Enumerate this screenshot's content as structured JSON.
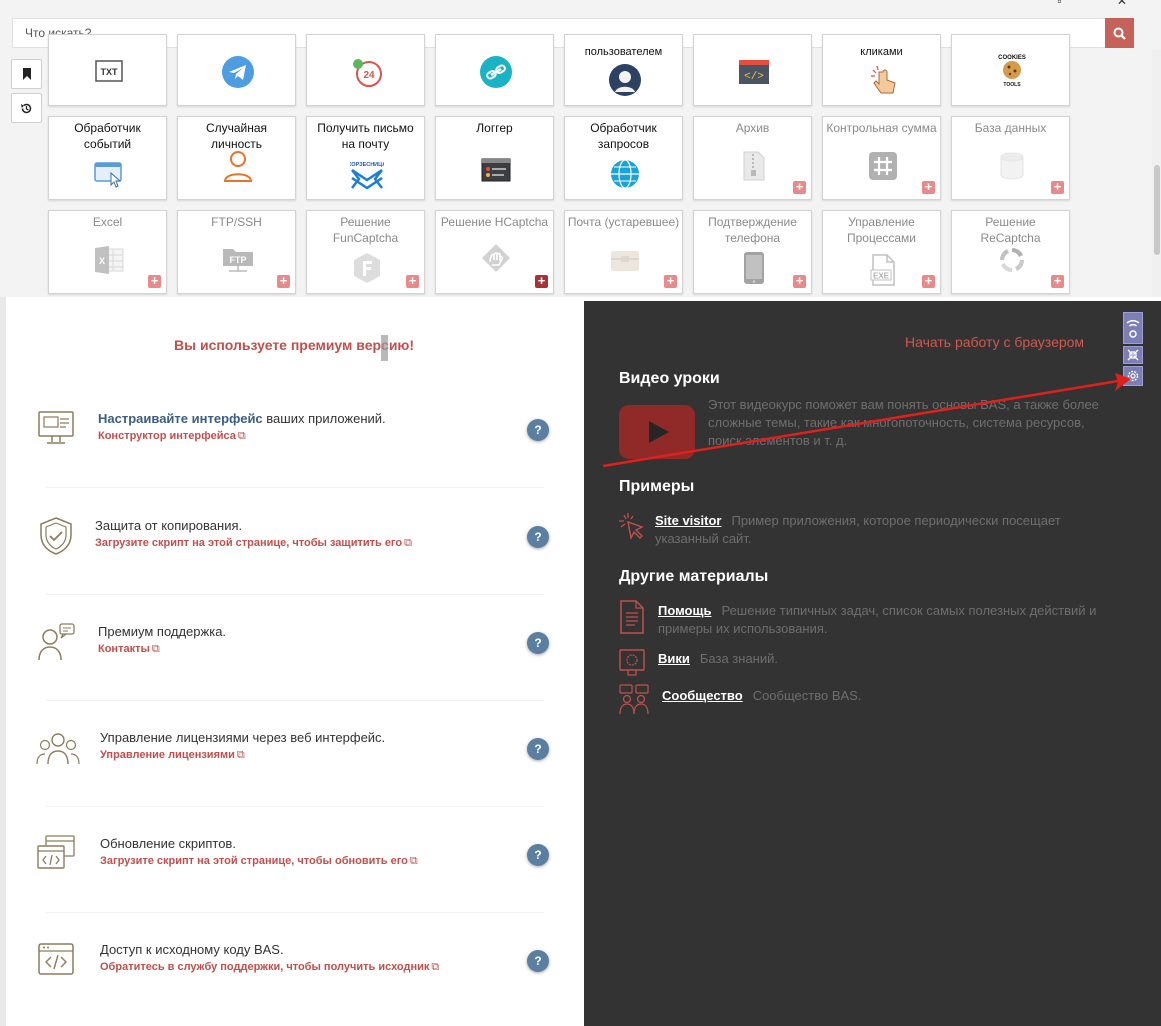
{
  "window": {
    "controls": "▫ ✕"
  },
  "search": {
    "placeholder": "Что искать?"
  },
  "tiles_row0": [
    {
      "label": "",
      "icon": "txt-icon"
    },
    {
      "label": "",
      "icon": "telegram-icon"
    },
    {
      "label": "",
      "icon": "24-hours-icon"
    },
    {
      "label": "",
      "icon": "link-icon"
    },
    {
      "label": "пользователем",
      "icon": "user-avatar-icon"
    },
    {
      "label": "",
      "icon": "code-window-icon"
    },
    {
      "label": "кликами",
      "icon": "pointer-hand-icon"
    },
    {
      "label": "",
      "icon": "cookies-tools-icon",
      "icon_text": "COOKIES TOOLS"
    }
  ],
  "tiles_row1": [
    {
      "label": "Обработчик событий",
      "icon": "event-window-icon"
    },
    {
      "label": "Случайная личность",
      "icon": "person-icon"
    },
    {
      "label": "Получить письмо на почту",
      "icon": "mail-logo-icon",
      "icon_text": "КОРЗЕСНИЦА"
    },
    {
      "label": "Логгер",
      "icon": "logger-icon"
    },
    {
      "label": "Обработчик запросов",
      "icon": "globe-icon"
    },
    {
      "label": "Архив",
      "icon": "zip-icon"
    },
    {
      "label": "Контрольная сумма",
      "icon": "hash-icon"
    },
    {
      "label": "База данных",
      "icon": "database-icon"
    }
  ],
  "tiles_row2": [
    {
      "label": "Excel",
      "icon": "excel-icon"
    },
    {
      "label": "FTP/SSH",
      "icon": "ftp-icon",
      "icon_text": "FTP"
    },
    {
      "label": "Решение FunCaptcha",
      "icon": "funcaptcha-icon"
    },
    {
      "label": "Решение HCaptcha",
      "icon": "hcaptcha-icon"
    },
    {
      "label": "Почта (устаревшее)",
      "icon": "mailbox-icon"
    },
    {
      "label": "Подтверждение телефона",
      "icon": "phone-icon"
    },
    {
      "label": "Управление Процессами",
      "icon": "exe-icon",
      "icon_text": "EXE"
    },
    {
      "label": "Решение ReCaptcha",
      "icon": "recaptcha-icon"
    }
  ],
  "premium": {
    "title": "Вы используете премиум версию!"
  },
  "features": [
    {
      "title_strong": "Настраивайте интерфейс",
      "title_rest": " ваших приложений.",
      "link": "Конструктор интерфейса",
      "help": "?"
    },
    {
      "title_strong": "",
      "title_rest": "Защита от копирования.",
      "link": "Загрузите скрипт на этой странице, чтобы защитить его",
      "help": "?"
    },
    {
      "title_strong": "",
      "title_rest": "Премиум поддержка.",
      "link": "Контакты",
      "help": "?"
    },
    {
      "title_strong": "",
      "title_rest": "Управление лицензиями через веб интерфейс.",
      "link": "Управление лицензиями",
      "help": "?"
    },
    {
      "title_strong": "",
      "title_rest": "Обновление скриптов.",
      "link": "Загрузите скрипт на этой странице, чтобы обновить его",
      "help": "?"
    },
    {
      "title_strong": "",
      "title_rest": "Доступ к исходному коду BAS.",
      "link": "Обратитесь в службу поддержки, чтобы получить исходник",
      "help": "?"
    }
  ],
  "right": {
    "start_link": "Начать работу с браузером",
    "video": {
      "heading": "Видео уроки",
      "text": "Этот видеокурс поможет вам понять основы BAS, а также более сложные темы, такие как многопоточность, система ресурсов, поиск элементов и т. д."
    },
    "examples": {
      "heading": "Примеры",
      "link": "Site visitor",
      "text": "Пример приложения, которое периодически посещает указанный сайт."
    },
    "other": {
      "heading": "Другие материалы",
      "help_link": "Помощь",
      "help_text": "Решение типичных задач, список самых полезных действий и примеры их использования.",
      "wiki_link": "Вики",
      "wiki_text": "База знаний.",
      "community_link": "Сообщество",
      "community_text": "Сообщество BAS."
    }
  },
  "colors": {
    "accent_red": "#c0504d",
    "search_button": "#c5635a",
    "dark_panel": "#333333",
    "help_badge": "#5b7fa0",
    "tool_buttons": "#7b7fb6",
    "annotation_arrow": "#e0201c"
  }
}
